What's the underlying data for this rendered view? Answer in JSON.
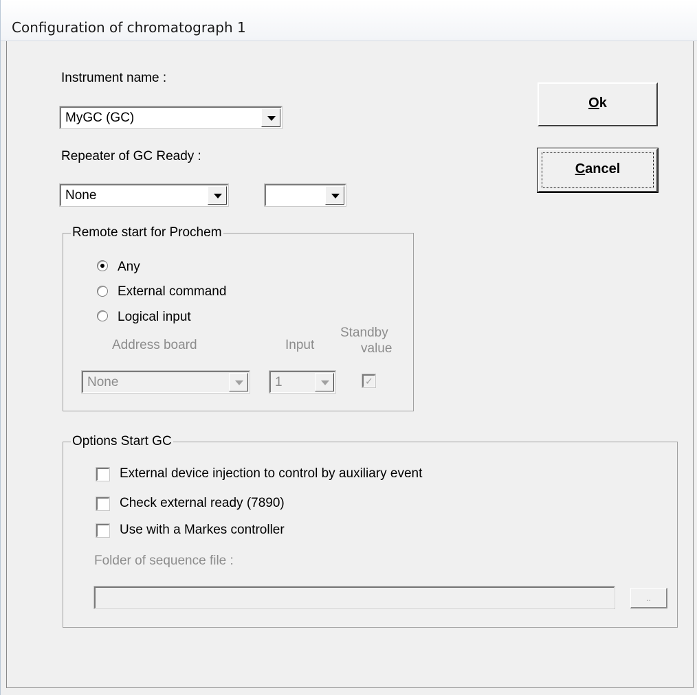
{
  "window": {
    "title": "Configuration of chromatograph 1"
  },
  "instrument": {
    "label": "Instrument name :",
    "value": "MyGC (GC)"
  },
  "repeater": {
    "label": "Repeater of GC Ready :",
    "value": "None",
    "second_value": ""
  },
  "buttons": {
    "ok": "Ok",
    "cancel": "Cancel"
  },
  "remote_start": {
    "legend": "Remote start for Prochem",
    "options": [
      "Any",
      "External command",
      "Logical input"
    ],
    "selected": "Any",
    "address_board_label": "Address board",
    "input_label": "Input",
    "standby_label_line1": "Standby",
    "standby_label_line2": "value",
    "address_board_value": "None",
    "input_value": "1",
    "standby_checked": true
  },
  "options_start": {
    "legend": "Options Start GC",
    "checks": [
      {
        "label": "External device injection to control by auxiliary event",
        "checked": false
      },
      {
        "label": "Check external ready (7890)",
        "checked": false
      },
      {
        "label": "Use with a Markes controller",
        "checked": false
      }
    ],
    "folder_label": "Folder of sequence file :",
    "folder_value": "",
    "browse_label": ".."
  },
  "icons": {
    "dropdown": "chevron-down-icon",
    "radio": "radio-icon",
    "checkbox": "checkbox-icon"
  }
}
